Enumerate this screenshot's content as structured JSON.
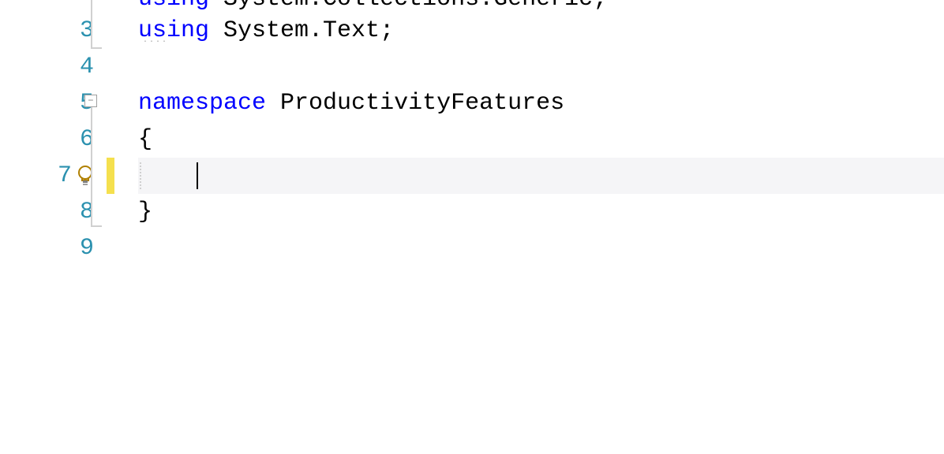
{
  "lines": {
    "partial_top": {
      "number": "",
      "keyword": "using",
      "type": "System.Collections.Generic",
      "semi": ";"
    },
    "l3": {
      "number": "3",
      "keyword": "using",
      "type": "System.Text",
      "semi": ";"
    },
    "l4": {
      "number": "4"
    },
    "l5": {
      "number": "5",
      "keyword": "namespace",
      "ident": "ProductivityFeatures"
    },
    "l6": {
      "number": "6",
      "brace": "{"
    },
    "l7": {
      "number": "7"
    },
    "l8": {
      "number": "8",
      "brace": "}"
    },
    "l9": {
      "number": "9"
    }
  },
  "fold_glyph": "−",
  "colors": {
    "keyword": "#0000ff",
    "line_number": "#2b91af",
    "change_bar": "#f5e04e"
  }
}
